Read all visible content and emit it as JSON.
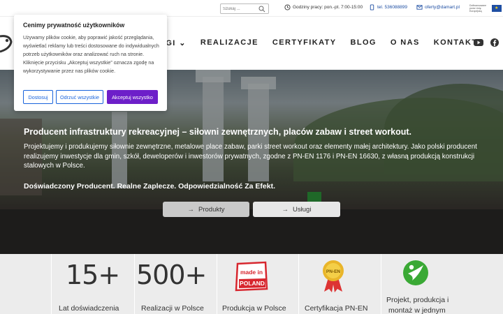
{
  "topbar": {
    "search_placeholder": "Szukaj ...",
    "hours": "Godziny pracy: pon.-pt. 7:00-15:00",
    "phone": "tel. 536088899",
    "email": "oferty@damart.pl",
    "eu_text": "Dofinansowane przez Unię Europejską"
  },
  "nav": {
    "items": [
      "USŁUGI",
      "REALIZACJE",
      "CERTYFIKATY",
      "BLOG",
      "O NAS",
      "KONTAKT"
    ],
    "partial_first": "UGI ⌄",
    "social_icons": [
      "youtube-icon",
      "facebook-icon"
    ]
  },
  "hero": {
    "title": "Producent infrastruktury rekreacyjnej – siłowni zewnętrznych, placów zabaw i street workout.",
    "description": "Projektujemy i produkujemy siłownie zewnętrzne, metalowe place zabaw, parki street workout oraz elementy małej architektury. Jako polski producent realizujemy inwestycje dla gmin, szkół, deweloperów i inwestorów prywatnych, zgodne z PN-EN 1176 i PN-EN 16630, z własną produkcją konstrukcji stalowych w Polsce.",
    "tagline": "Doświadczony Producent. Realne Zaplecze. Odpowiedzialność Za Efekt.",
    "btn_products": "Produkty",
    "btn_services": "Usługi"
  },
  "stats": {
    "years_num": "15+",
    "years_label": "Lat doświadczenia",
    "projects_num": "500+",
    "projects_label": "Realizacji w Polsce",
    "made_label": "Produkcja w Polsce",
    "made_badge_1": "made in",
    "made_badge_2": "POLAND",
    "cert_label": "Certyfikacja PN-EN",
    "cert_badge": "PN-EN",
    "full_label_1": "Projekt, produkcja i",
    "full_label_2": "montaż w jednym"
  },
  "cookie": {
    "title": "Cenimy prywatność użytkowników",
    "text": "Używamy plików cookie, aby poprawić jakość przeglądania, wyświetlać reklamy lub treści dostosowane do indywidualnych potrzeb użytkowników oraz analizować ruch na stronie. Kliknięcie przycisku „Akceptuj wszystkie” oznacza zgodę na wykorzystywanie przez nas plików cookie.",
    "btn_customize": "Dostosuj",
    "btn_reject": "Odrzuć wszystkie",
    "btn_accept": "Akceptuj wszystko"
  },
  "colors": {
    "accept_button": "#6d1fc9",
    "outline_button": "#1863dc",
    "stats_bg": "#ececec",
    "logo_green": "#3aa935"
  }
}
